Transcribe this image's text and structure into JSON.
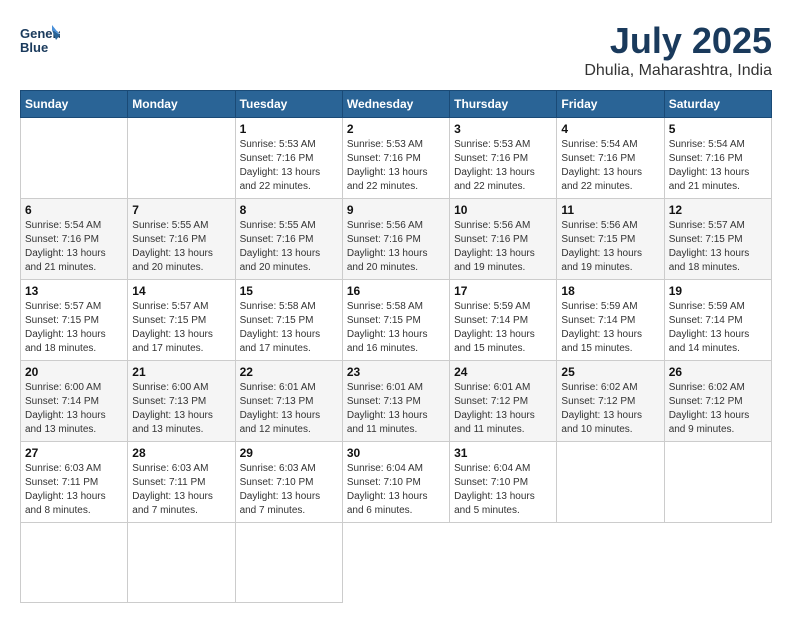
{
  "logo": {
    "line1": "General",
    "line2": "Blue"
  },
  "title": "July 2025",
  "location": "Dhulia, Maharashtra, India",
  "weekdays": [
    "Sunday",
    "Monday",
    "Tuesday",
    "Wednesday",
    "Thursday",
    "Friday",
    "Saturday"
  ],
  "days": [
    {
      "day": null,
      "info": null
    },
    {
      "day": null,
      "info": null
    },
    {
      "day": "1",
      "info": "Sunrise: 5:53 AM\nSunset: 7:16 PM\nDaylight: 13 hours and 22 minutes."
    },
    {
      "day": "2",
      "info": "Sunrise: 5:53 AM\nSunset: 7:16 PM\nDaylight: 13 hours and 22 minutes."
    },
    {
      "day": "3",
      "info": "Sunrise: 5:53 AM\nSunset: 7:16 PM\nDaylight: 13 hours and 22 minutes."
    },
    {
      "day": "4",
      "info": "Sunrise: 5:54 AM\nSunset: 7:16 PM\nDaylight: 13 hours and 22 minutes."
    },
    {
      "day": "5",
      "info": "Sunrise: 5:54 AM\nSunset: 7:16 PM\nDaylight: 13 hours and 21 minutes."
    },
    {
      "day": "6",
      "info": "Sunrise: 5:54 AM\nSunset: 7:16 PM\nDaylight: 13 hours and 21 minutes."
    },
    {
      "day": "7",
      "info": "Sunrise: 5:55 AM\nSunset: 7:16 PM\nDaylight: 13 hours and 20 minutes."
    },
    {
      "day": "8",
      "info": "Sunrise: 5:55 AM\nSunset: 7:16 PM\nDaylight: 13 hours and 20 minutes."
    },
    {
      "day": "9",
      "info": "Sunrise: 5:56 AM\nSunset: 7:16 PM\nDaylight: 13 hours and 20 minutes."
    },
    {
      "day": "10",
      "info": "Sunrise: 5:56 AM\nSunset: 7:16 PM\nDaylight: 13 hours and 19 minutes."
    },
    {
      "day": "11",
      "info": "Sunrise: 5:56 AM\nSunset: 7:15 PM\nDaylight: 13 hours and 19 minutes."
    },
    {
      "day": "12",
      "info": "Sunrise: 5:57 AM\nSunset: 7:15 PM\nDaylight: 13 hours and 18 minutes."
    },
    {
      "day": "13",
      "info": "Sunrise: 5:57 AM\nSunset: 7:15 PM\nDaylight: 13 hours and 18 minutes."
    },
    {
      "day": "14",
      "info": "Sunrise: 5:57 AM\nSunset: 7:15 PM\nDaylight: 13 hours and 17 minutes."
    },
    {
      "day": "15",
      "info": "Sunrise: 5:58 AM\nSunset: 7:15 PM\nDaylight: 13 hours and 17 minutes."
    },
    {
      "day": "16",
      "info": "Sunrise: 5:58 AM\nSunset: 7:15 PM\nDaylight: 13 hours and 16 minutes."
    },
    {
      "day": "17",
      "info": "Sunrise: 5:59 AM\nSunset: 7:14 PM\nDaylight: 13 hours and 15 minutes."
    },
    {
      "day": "18",
      "info": "Sunrise: 5:59 AM\nSunset: 7:14 PM\nDaylight: 13 hours and 15 minutes."
    },
    {
      "day": "19",
      "info": "Sunrise: 5:59 AM\nSunset: 7:14 PM\nDaylight: 13 hours and 14 minutes."
    },
    {
      "day": "20",
      "info": "Sunrise: 6:00 AM\nSunset: 7:14 PM\nDaylight: 13 hours and 13 minutes."
    },
    {
      "day": "21",
      "info": "Sunrise: 6:00 AM\nSunset: 7:13 PM\nDaylight: 13 hours and 13 minutes."
    },
    {
      "day": "22",
      "info": "Sunrise: 6:01 AM\nSunset: 7:13 PM\nDaylight: 13 hours and 12 minutes."
    },
    {
      "day": "23",
      "info": "Sunrise: 6:01 AM\nSunset: 7:13 PM\nDaylight: 13 hours and 11 minutes."
    },
    {
      "day": "24",
      "info": "Sunrise: 6:01 AM\nSunset: 7:12 PM\nDaylight: 13 hours and 11 minutes."
    },
    {
      "day": "25",
      "info": "Sunrise: 6:02 AM\nSunset: 7:12 PM\nDaylight: 13 hours and 10 minutes."
    },
    {
      "day": "26",
      "info": "Sunrise: 6:02 AM\nSunset: 7:12 PM\nDaylight: 13 hours and 9 minutes."
    },
    {
      "day": "27",
      "info": "Sunrise: 6:03 AM\nSunset: 7:11 PM\nDaylight: 13 hours and 8 minutes."
    },
    {
      "day": "28",
      "info": "Sunrise: 6:03 AM\nSunset: 7:11 PM\nDaylight: 13 hours and 7 minutes."
    },
    {
      "day": "29",
      "info": "Sunrise: 6:03 AM\nSunset: 7:10 PM\nDaylight: 13 hours and 7 minutes."
    },
    {
      "day": "30",
      "info": "Sunrise: 6:04 AM\nSunset: 7:10 PM\nDaylight: 13 hours and 6 minutes."
    },
    {
      "day": "31",
      "info": "Sunrise: 6:04 AM\nSunset: 7:10 PM\nDaylight: 13 hours and 5 minutes."
    },
    {
      "day": null,
      "info": null
    },
    {
      "day": null,
      "info": null
    },
    {
      "day": null,
      "info": null
    },
    {
      "day": null,
      "info": null
    },
    {
      "day": null,
      "info": null
    }
  ]
}
